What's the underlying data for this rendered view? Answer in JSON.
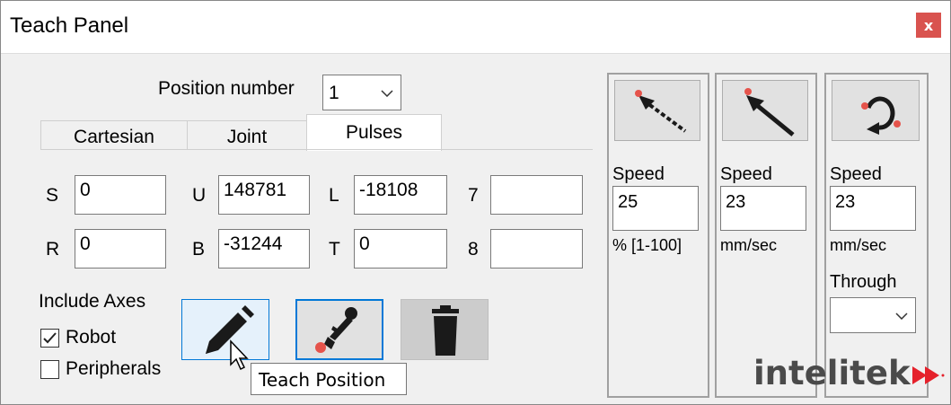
{
  "window": {
    "title": "Teach Panel",
    "close_label": "x"
  },
  "position": {
    "label": "Position number",
    "value": "1"
  },
  "tabs": [
    {
      "label": "Cartesian",
      "active": false
    },
    {
      "label": "Joint",
      "active": false
    },
    {
      "label": "Pulses",
      "active": true
    }
  ],
  "axes": {
    "S": {
      "label": "S",
      "value": "0"
    },
    "U": {
      "label": "U",
      "value": "148781"
    },
    "L": {
      "label": "L",
      "value": "-18108"
    },
    "A7": {
      "label": "7",
      "value": ""
    },
    "R": {
      "label": "R",
      "value": "0"
    },
    "B": {
      "label": "B",
      "value": "-31244"
    },
    "T": {
      "label": "T",
      "value": "0"
    },
    "A8": {
      "label": "8",
      "value": ""
    }
  },
  "include_axes": {
    "label": "Include Axes",
    "robot": {
      "label": "Robot",
      "checked": true
    },
    "peripherals": {
      "label": "Peripherals",
      "checked": false
    }
  },
  "actions": {
    "teach_icon": "pencil-icon",
    "gripper_icon": "robot-arm-icon",
    "delete_icon": "trash-icon"
  },
  "tooltip": "Teach Position",
  "motion_panels": [
    {
      "icon": "joint-move-icon",
      "speed_label": "Speed",
      "speed_value": "25",
      "unit": "% [1-100]"
    },
    {
      "icon": "linear-move-icon",
      "speed_label": "Speed",
      "speed_value": "23",
      "unit": "mm/sec"
    },
    {
      "icon": "circular-move-icon",
      "speed_label": "Speed",
      "speed_value": "23",
      "unit": "mm/sec",
      "through_label": "Through",
      "through_value": ""
    }
  ],
  "brand": {
    "name": "intelitek",
    "accent": "#e5212b"
  }
}
